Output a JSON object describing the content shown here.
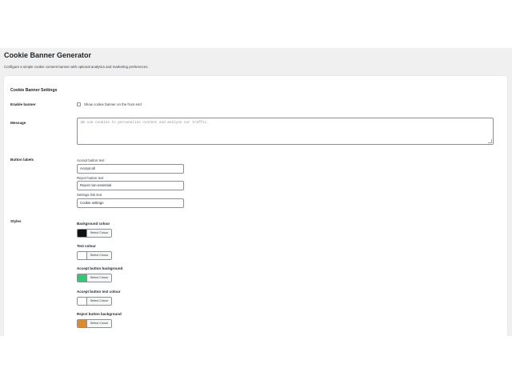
{
  "page": {
    "title": "Cookie Banner Generator",
    "description": "Configure a simple cookie consent banner with optional analytics and marketing preferences."
  },
  "settings": {
    "section_title": "Cookie Banner Settings",
    "enable": {
      "label": "Enable banner",
      "checkbox_label": "Show cookie banner on the front end",
      "checked": false
    },
    "message": {
      "label": "Message",
      "placeholder": "We use cookies to personalise content and analyse our traffic."
    },
    "button_labels": {
      "label": "Button labels",
      "accept": {
        "label": "Accept button text",
        "value": "Accept all"
      },
      "reject": {
        "label": "Reject button text",
        "value": "Reject non-essential"
      },
      "settings": {
        "label": "Settings link text",
        "value": "Cookie settings"
      }
    },
    "styles": {
      "label": "Styles",
      "select_label": "Select Colour",
      "items": [
        {
          "label": "Background colour",
          "color": "#111111"
        },
        {
          "label": "Text colour",
          "color": "#ffffff"
        },
        {
          "label": "Accept button background",
          "color": "#2ecc71"
        },
        {
          "label": "Accept button text colour",
          "color": "#ffffff"
        },
        {
          "label": "Reject button background",
          "color": "#e08a2c"
        }
      ]
    }
  }
}
